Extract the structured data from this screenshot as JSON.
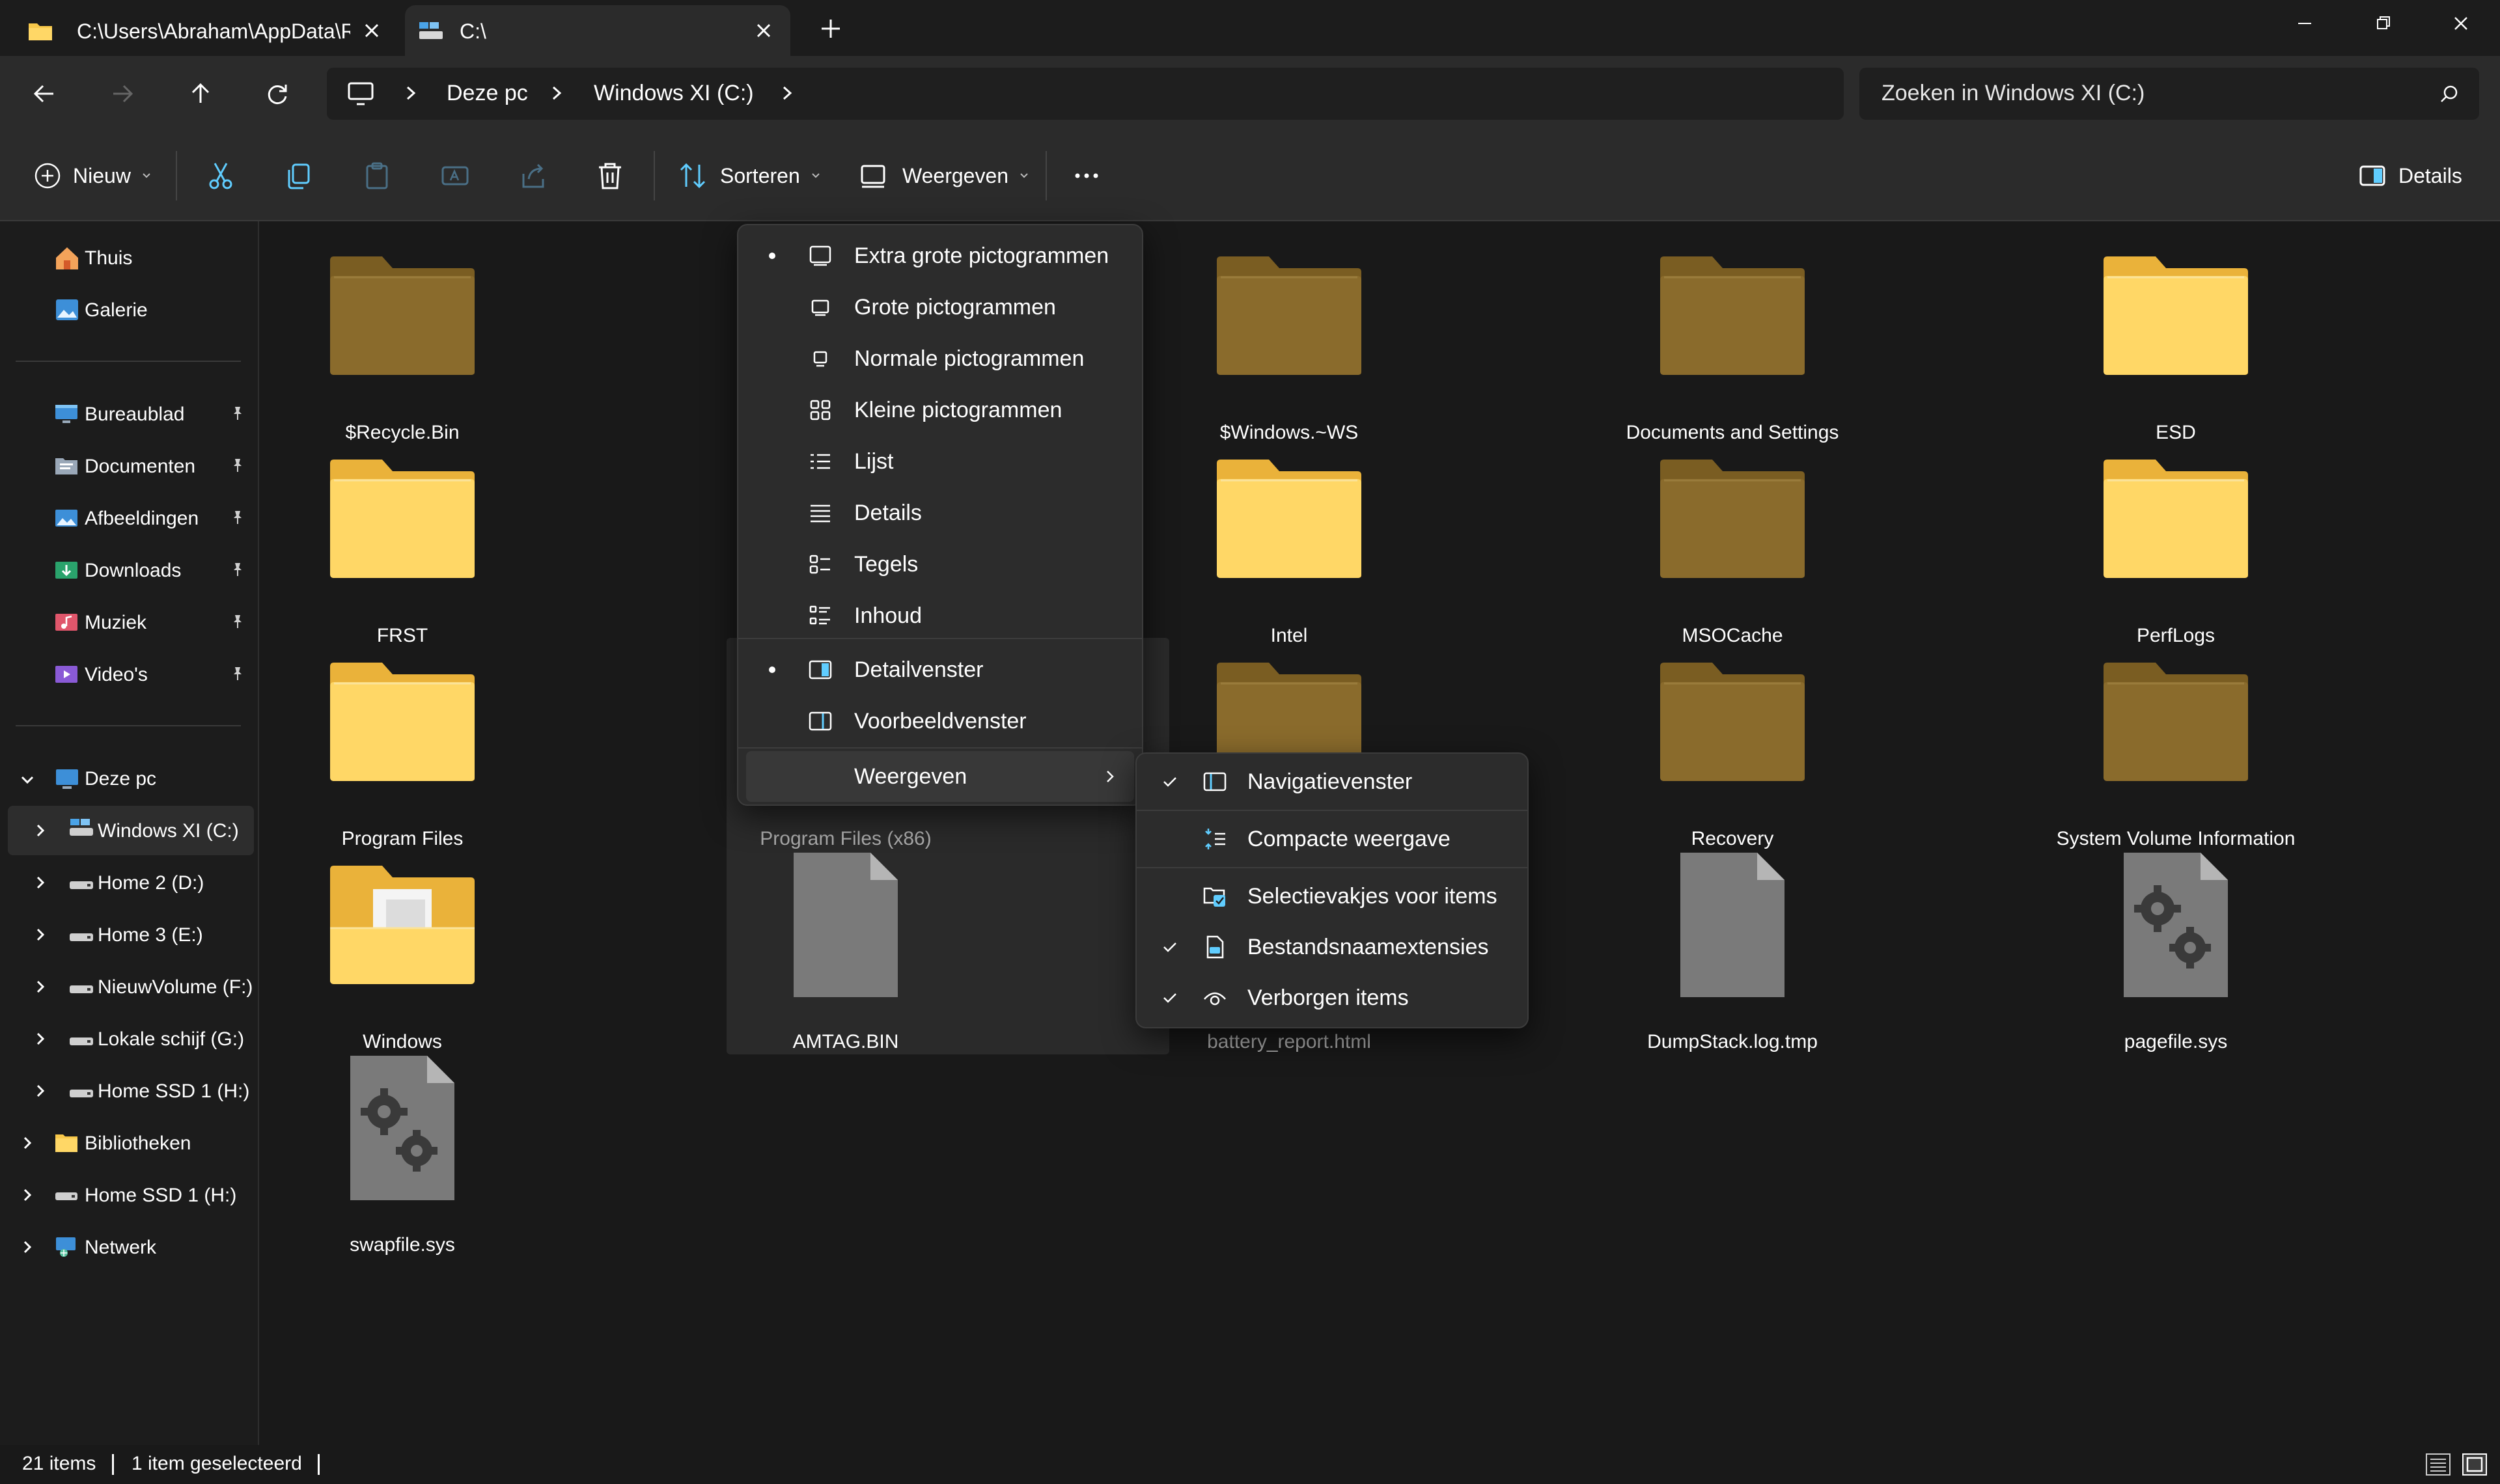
{
  "tabs": [
    {
      "title": "C:\\Users\\Abraham\\AppData\\Rc",
      "active": false
    },
    {
      "title": "C:\\",
      "active": true
    }
  ],
  "addressbar": {
    "crumbs": [
      "Deze pc",
      "Windows XI (C:)"
    ],
    "search_placeholder": "Zoeken in Windows XI (C:)"
  },
  "toolbar": {
    "new_label": "Nieuw",
    "sort_label": "Sorteren",
    "view_label": "Weergeven",
    "details_label": "Details"
  },
  "nav": {
    "quick": [
      {
        "label": "Thuis",
        "icon": "home-icon"
      },
      {
        "label": "Galerie",
        "icon": "gallery-icon"
      }
    ],
    "pinned": [
      {
        "label": "Bureaublad",
        "icon": "desktop-icon"
      },
      {
        "label": "Documenten",
        "icon": "documents-icon"
      },
      {
        "label": "Afbeeldingen",
        "icon": "pictures-icon"
      },
      {
        "label": "Downloads",
        "icon": "downloads-icon"
      },
      {
        "label": "Muziek",
        "icon": "music-icon"
      },
      {
        "label": "Video's",
        "icon": "videos-icon"
      }
    ],
    "this_pc": "Deze pc",
    "drives": [
      "Windows XI (C:)",
      "Home 2 (D:)",
      "Home 3 (E:)",
      "NieuwVolume (F:)",
      "Lokale schijf (G:)",
      "Home SSD 1 (H:)"
    ],
    "bottom": [
      {
        "label": "Bibliotheken",
        "icon": "libraries-icon"
      },
      {
        "label": "Home SSD 1 (H:)",
        "icon": "drive-icon"
      },
      {
        "label": "Netwerk",
        "icon": "network-icon"
      }
    ]
  },
  "files": [
    {
      "name": "$Recycle.Bin",
      "kind": "folder-dim"
    },
    {
      "name": "",
      "kind": "hidden-by-menu"
    },
    {
      "name": "$Windows.~WS",
      "kind": "folder-dim"
    },
    {
      "name": "Documents and Settings",
      "kind": "folder-dim"
    },
    {
      "name": "ESD",
      "kind": "folder"
    },
    {
      "name": "FRST",
      "kind": "folder"
    },
    {
      "name": "",
      "kind": "hidden-by-menu"
    },
    {
      "name": "Intel",
      "kind": "folder"
    },
    {
      "name": "MSOCache",
      "kind": "folder-dim"
    },
    {
      "name": "PerfLogs",
      "kind": "folder"
    },
    {
      "name": "Program Files",
      "kind": "folder"
    },
    {
      "name": "Program Files (x86)",
      "kind": "hidden-by-menu"
    },
    {
      "name": "",
      "kind": "folder-dim"
    },
    {
      "name": "Recovery",
      "kind": "folder-dim"
    },
    {
      "name": "System Volume Information",
      "kind": "folder-dim"
    },
    {
      "name": "Windows",
      "kind": "folder-open"
    },
    {
      "name": "AMTAG.BIN",
      "kind": "file"
    },
    {
      "name": "battery_report.html",
      "kind": "hidden-by-menu"
    },
    {
      "name": "DumpStack.log.tmp",
      "kind": "file"
    },
    {
      "name": "pagefile.sys",
      "kind": "sys"
    },
    {
      "name": "swapfile.sys",
      "kind": "sys"
    }
  ],
  "view_menu": {
    "layouts": [
      {
        "label": "Extra grote pictogrammen",
        "selected": true,
        "icon": "extra-large-icons-icon"
      },
      {
        "label": "Grote pictogrammen",
        "selected": false,
        "icon": "large-icons-icon"
      },
      {
        "label": "Normale pictogrammen",
        "selected": false,
        "icon": "medium-icons-icon"
      },
      {
        "label": "Kleine pictogrammen",
        "selected": false,
        "icon": "small-icons-icon"
      },
      {
        "label": "Lijst",
        "selected": false,
        "icon": "list-icon"
      },
      {
        "label": "Details",
        "selected": false,
        "icon": "details-icon"
      },
      {
        "label": "Tegels",
        "selected": false,
        "icon": "tiles-icon"
      },
      {
        "label": "Inhoud",
        "selected": false,
        "icon": "content-icon"
      }
    ],
    "panes": [
      {
        "label": "Detailvenster",
        "selected": true,
        "icon": "details-pane-icon"
      },
      {
        "label": "Voorbeeldvenster",
        "selected": false,
        "icon": "preview-pane-icon"
      }
    ],
    "submenu_label": "Weergeven"
  },
  "show_menu": {
    "items": [
      {
        "label": "Navigatievenster",
        "checked": true,
        "icon": "navigation-pane-icon"
      },
      {
        "label": "Compacte weergave",
        "checked": false,
        "icon": "compact-view-icon"
      },
      {
        "label": "Selectievakjes voor items",
        "checked": false,
        "icon": "checkboxes-icon"
      },
      {
        "label": "Bestandsnaamextensies",
        "checked": true,
        "icon": "file-extensions-icon"
      },
      {
        "label": "Verborgen items",
        "checked": true,
        "icon": "hidden-items-icon"
      }
    ]
  },
  "status": {
    "count": "21 items",
    "selected": "1 item geselecteerd"
  },
  "colors": {
    "accent": "#60cdff",
    "folder": "#f8c84a",
    "folder_dim": "#8a6b2c"
  }
}
